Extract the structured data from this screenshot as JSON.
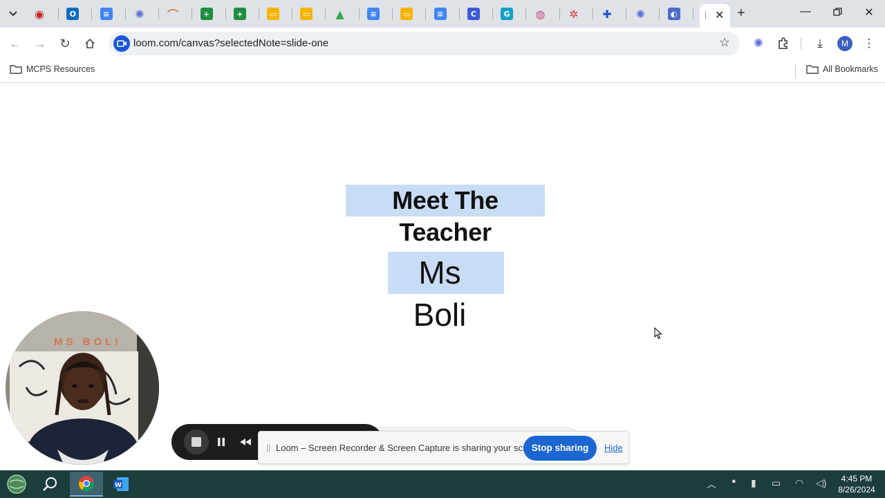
{
  "browser": {
    "url": "loom.com/canvas?selectedNote=slide-one",
    "tabs": [
      {
        "icon": "record-icon",
        "color": "#c5221f"
      },
      {
        "icon": "outlook-icon",
        "color": "#0f6cbd"
      },
      {
        "icon": "docs-icon",
        "color": "#4285f4"
      },
      {
        "icon": "asterisk-icon",
        "color": "#5b6fd8"
      },
      {
        "icon": "rainbow-icon",
        "color": "#e07a3b"
      },
      {
        "icon": "sheets-icon",
        "color": "#1e8e3e"
      },
      {
        "icon": "sheets-icon",
        "color": "#1e8e3e"
      },
      {
        "icon": "slides-icon",
        "color": "#f4b400"
      },
      {
        "icon": "slides-icon",
        "color": "#f4b400"
      },
      {
        "icon": "drive-icon",
        "color": "#34a853"
      },
      {
        "icon": "docs-icon",
        "color": "#4285f4"
      },
      {
        "icon": "slides-icon",
        "color": "#f4b400"
      },
      {
        "icon": "docs-icon",
        "color": "#4285f4"
      },
      {
        "icon": "c-icon",
        "color": "#3c5bd6"
      },
      {
        "icon": "g-icon",
        "color": "#15a0c9"
      },
      {
        "icon": "circle-logo-icon",
        "color": "#c44b7d"
      },
      {
        "icon": "wheel-icon",
        "color": "#d93a3a"
      },
      {
        "icon": "puzzle-icon",
        "color": "#2352c9"
      },
      {
        "icon": "asterisk-icon",
        "color": "#5b6fd8"
      },
      {
        "icon": "chat-icon",
        "color": "#4a69c9"
      }
    ],
    "bookmarks": {
      "left_label": "MCPS Resources",
      "right_label": "All Bookmarks"
    },
    "profile_initial": "M"
  },
  "slide": {
    "title": "Meet The Teacher",
    "name": "Ms Boli"
  },
  "webcam": {
    "banner_text": "MS BOLI"
  },
  "screen_share": {
    "message": "Loom – Screen Recorder & Screen Capture is sharing your screen.",
    "stop_label": "Stop sharing",
    "hide_label": "Hide"
  },
  "taskbar": {
    "time": "4:45 PM",
    "date": "8/26/2024"
  }
}
